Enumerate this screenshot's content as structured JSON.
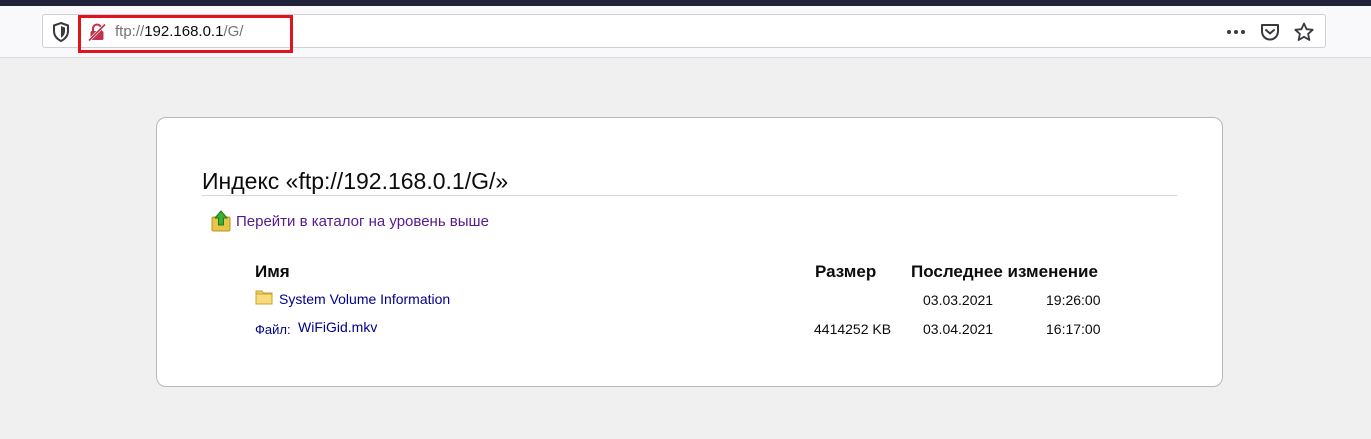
{
  "browser": {
    "url_gray_prefix": "ftp://",
    "url_host": "192.168.0.1",
    "url_gray_suffix": "/G/"
  },
  "page": {
    "title": "Индекс «ftp://192.168.0.1/G/»",
    "up_link": "Перейти в каталог на уровень выше",
    "columns": {
      "name": "Имя",
      "size": "Размер",
      "modified": "Последнее изменение"
    },
    "rows": [
      {
        "name": "System Volume Information",
        "prefix": "",
        "size": "",
        "date": "03.03.2021",
        "time": "19:26:00",
        "icon": "folder-icon"
      },
      {
        "name": "WiFiGid.mkv",
        "prefix": "Файл:",
        "size": "4414252 KB",
        "date": "03.04.2021",
        "time": "16:17:00",
        "icon": ""
      }
    ]
  },
  "colors": {
    "highlight": "#e0141a",
    "visited_link": "#551a8b",
    "link": "#00008b"
  }
}
